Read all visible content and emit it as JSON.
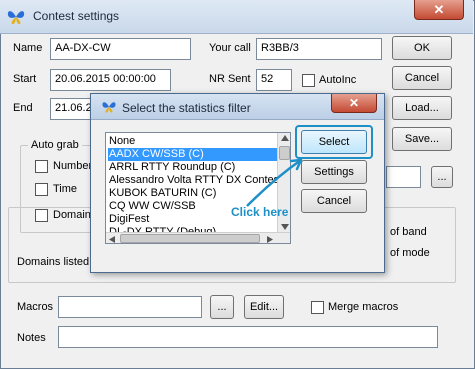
{
  "window": {
    "title": "Contest settings",
    "close_glyph": "✕"
  },
  "fields": {
    "name_label": "Name",
    "name_value": "AA-DX-CW",
    "yourcall_label": "Your call",
    "yourcall_value": "R3BB/3",
    "start_label": "Start",
    "start_value": "20.06.2015 00:00:00",
    "nrsent_label": "NR Sent",
    "nrsent_value": "52",
    "autoinc_label": "AutoInc",
    "end_label": "End",
    "end_value": "21.06.20"
  },
  "buttons": {
    "ok": "OK",
    "cancel": "Cancel",
    "load": "Load...",
    "save": "Save...",
    "browse": "...",
    "macros_browse": "...",
    "edit": "Edit..."
  },
  "autograb": {
    "title": "Auto grab",
    "number": "Number",
    "time": "Time",
    "domain": "Domain"
  },
  "right_partial": {
    "band": "of band",
    "mode": "of mode"
  },
  "domains_text": "Domains listed i",
  "macros": {
    "label": "Macros",
    "merge_label": "Merge macros"
  },
  "notes": {
    "label": "Notes"
  },
  "dialog": {
    "title": "Select the statistics filter",
    "close_glyph": "✕",
    "items": [
      {
        "label": "None"
      },
      {
        "label": "AADX CW/SSB (C)"
      },
      {
        "label": "ARRL RTTY Roundup (C)"
      },
      {
        "label": "Alessandro Volta RTTY DX Contes"
      },
      {
        "label": "KUBOK BATURIN (C)"
      },
      {
        "label": "CQ WW CW/SSB"
      },
      {
        "label": "DigiFest"
      },
      {
        "label": "DL-DX RTTY (Debug)"
      }
    ],
    "select": "Select",
    "settings": "Settings",
    "cancel": "Cancel"
  },
  "annotation": {
    "text": "Click here",
    "color": "#1e90c8"
  }
}
